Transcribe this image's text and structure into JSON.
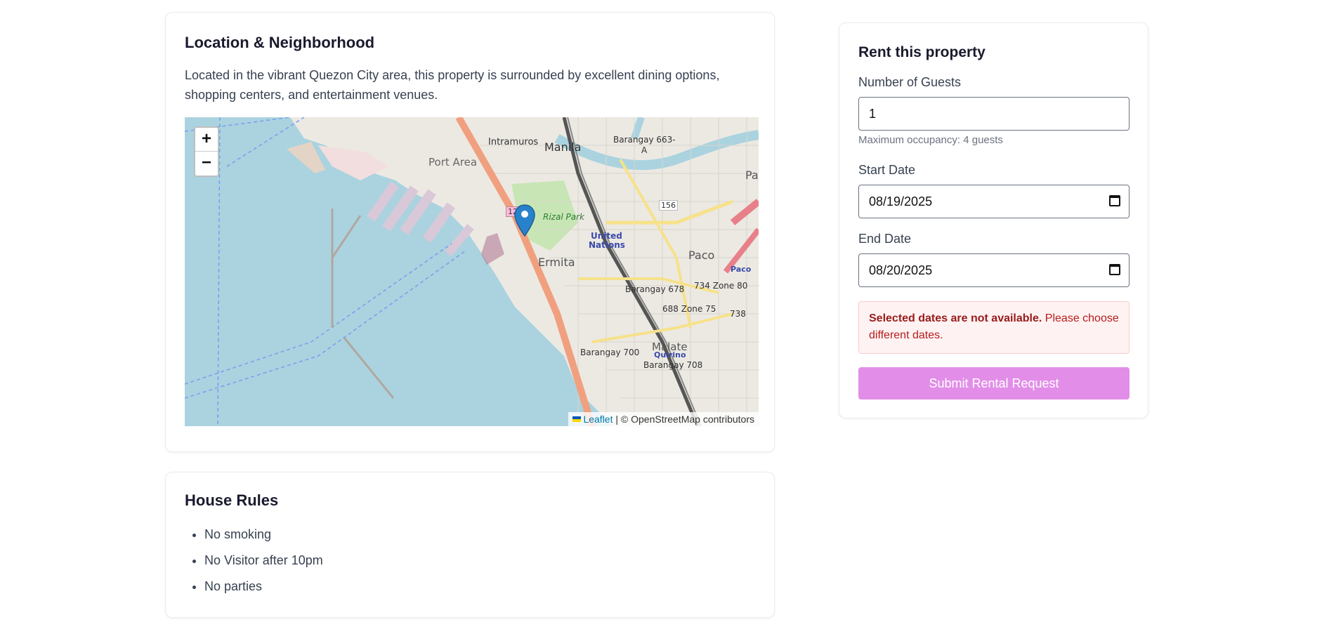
{
  "location": {
    "title": "Location & Neighborhood",
    "description": "Located in the vibrant Quezon City area, this property is surrounded by excellent dining options, shopping centers, and entertainment venues.",
    "map": {
      "zoom_in": "+",
      "zoom_out": "−",
      "attribution_leaflet": "Leaflet",
      "attribution_rest": "| © OpenStreetMap contributors",
      "labels": {
        "intramuros": "Intramuros",
        "manila": "Manila",
        "port_area": "Port Area",
        "barangay_663": "Barangay 663-",
        "barangay_663_a": "A",
        "rizal_park": "Rizal Park",
        "united": "United",
        "nations": "Nations",
        "paco": "Paco",
        "paco_station": "Paco",
        "pa": "Pa",
        "ermita": "Ermita",
        "barangay_678": "Barangay 678",
        "zone_80": "734 Zone 80",
        "zone_75": "688 Zone 75",
        "n738": "738",
        "n156": "156",
        "n12": "12",
        "barangay_700": "Barangay 700",
        "malate": "Malate",
        "quirino": "Quirino",
        "barangay_708": "Barangay 708"
      }
    }
  },
  "house_rules": {
    "title": "House Rules",
    "items": [
      "No smoking",
      "No Visitor after 10pm",
      "No parties"
    ]
  },
  "rent": {
    "title": "Rent this property",
    "guests_label": "Number of Guests",
    "guests_value": "1",
    "max_occupancy": "Maximum occupancy: 4 guests",
    "start_label": "Start Date",
    "start_value": "08/19/2025",
    "end_label": "End Date",
    "end_value": "08/20/2025",
    "error_bold": "Selected dates are not available.",
    "error_rest": " Please choose different dates.",
    "submit_label": "Submit Rental Request"
  },
  "colors": {
    "submit": "#e28ee8",
    "error_bg": "#fef2f2",
    "error_text": "#b91c1c",
    "water": "#aad3df",
    "marker": "#2a81cb"
  }
}
